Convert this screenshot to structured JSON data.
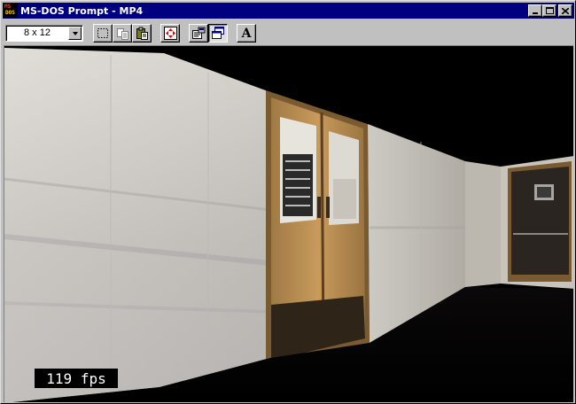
{
  "window": {
    "title": "MS-DOS Prompt - MP4",
    "app_icon": "ms-dos-icon",
    "controls": [
      "minimize-icon",
      "maximize-icon",
      "close-icon"
    ]
  },
  "toolbar": {
    "font_size_value": "8 x 12",
    "buttons": [
      {
        "name": "mark-button",
        "icon": "mark-icon"
      },
      {
        "name": "copy-button",
        "icon": "copy-icon"
      },
      {
        "name": "paste-button",
        "icon": "paste-icon"
      },
      {
        "name": "fullscreen-button",
        "icon": "fullscreen-icon"
      },
      {
        "name": "properties-button",
        "icon": "properties-icon"
      },
      {
        "name": "background-button",
        "icon": "background-icon",
        "pressed": true
      },
      {
        "name": "font-button",
        "label": "A"
      }
    ]
  },
  "game": {
    "fps_text": "119 fps"
  },
  "colors": {
    "titlebar": "#000080",
    "chrome": "#c0c0c0",
    "viewport_bg": "#000000",
    "wall": "#c8c4c0",
    "door": "#b88a4a"
  }
}
